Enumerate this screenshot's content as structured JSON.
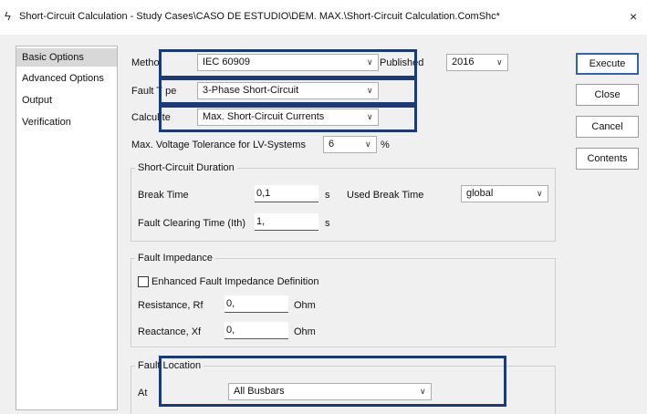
{
  "window": {
    "title": "Short-Circuit Calculation - Study Cases\\CASO DE ESTUDIO\\DEM. MAX.\\Short-Circuit Calculation.ComShc*",
    "title_icon": "lightning-icon",
    "close_glyph": "×"
  },
  "nav": {
    "items": [
      {
        "label": "Basic Options",
        "selected": true
      },
      {
        "label": "Advanced Options",
        "selected": false
      },
      {
        "label": "Output",
        "selected": false
      },
      {
        "label": "Verification",
        "selected": false
      }
    ]
  },
  "form": {
    "method_label": "Metho",
    "method_value": "IEC 60909",
    "published_label": "Publ",
    "published_label_tail": "shed",
    "published_value": "2016",
    "fault_type_label_a": "Fault T",
    "fault_type_label_b": "pe",
    "fault_type_value": "3-Phase Short-Circuit",
    "calculate_label_a": "Calcul",
    "calculate_label_b": "te",
    "calculate_value": "Max. Short-Circuit Currents",
    "voltage_tol_label": "Max. Voltage Tolerance for LV-Systems",
    "voltage_tol_value": "6",
    "voltage_tol_unit": "%"
  },
  "duration": {
    "title": "Short-Circuit Duration",
    "break_time_label": "Break Time",
    "break_time_value": "0,1",
    "break_time_unit": "s",
    "used_break_time_label": "Used Break Time",
    "used_break_time_value": "global",
    "clearing_label": "Fault Clearing Time (Ith)",
    "clearing_value": "1,",
    "clearing_unit": "s"
  },
  "impedance": {
    "title": "Fault Impedance",
    "enhanced_label": "Enhanced Fault Impedance Definition",
    "enhanced_checked": false,
    "rf_label": "Resistance, Rf",
    "rf_value": "0,",
    "rf_unit": "Ohm",
    "xf_label": "Reactance, Xf",
    "xf_value": "0,",
    "xf_unit": "Ohm"
  },
  "location": {
    "title_a": "Fault",
    "title_b": "Location",
    "at_label": "At",
    "at_value": "All Busbars"
  },
  "buttons": {
    "execute": "Execute",
    "close": "Close",
    "cancel": "Cancel",
    "contents": "Contents"
  },
  "colors": {
    "highlight_box": "#1a3a7a",
    "default_button_border": "#2f63b6",
    "dialog_bg": "#f0f0f0"
  }
}
